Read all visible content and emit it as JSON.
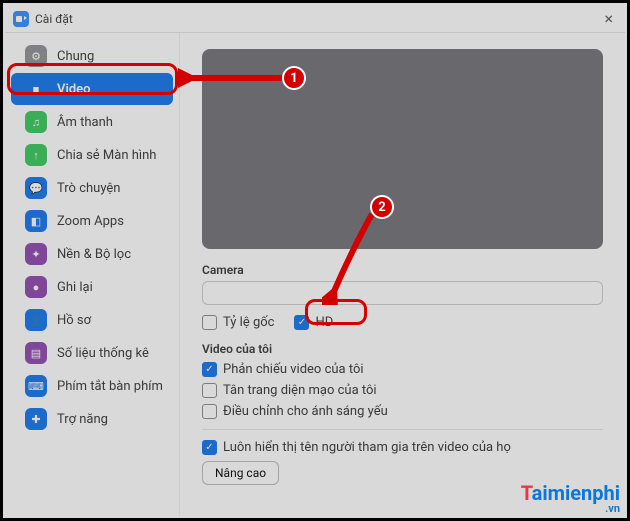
{
  "window": {
    "title": "Cài đặt"
  },
  "sidebar": {
    "items": [
      {
        "label": "Chung"
      },
      {
        "label": "Video"
      },
      {
        "label": "Âm thanh"
      },
      {
        "label": "Chia sẻ Màn hình"
      },
      {
        "label": "Trò chuyện"
      },
      {
        "label": "Zoom Apps"
      },
      {
        "label": "Nền & Bộ lọc"
      },
      {
        "label": "Ghi lại"
      },
      {
        "label": "Hồ sơ"
      },
      {
        "label": "Số liệu thống kê"
      },
      {
        "label": "Phím tắt bàn phím"
      },
      {
        "label": "Trợ năng"
      }
    ]
  },
  "content": {
    "camera_label": "Camera",
    "aspect_original": "Tỷ lệ gốc",
    "hd": "HD",
    "my_video_heading": "Video của tôi",
    "mirror": "Phản chiếu video của tôi",
    "touch_up": "Tân trang diện mạo của tôi",
    "low_light": "Điều chỉnh cho ánh sáng yếu",
    "always_names": "Luôn hiển thị tên người tham gia trên video của họ",
    "advanced": "Nâng cao"
  },
  "annotations": {
    "step1": "1",
    "step2": "2"
  },
  "watermark": {
    "blue": "aimienphi",
    "red": "T",
    "domain": ".vn"
  }
}
